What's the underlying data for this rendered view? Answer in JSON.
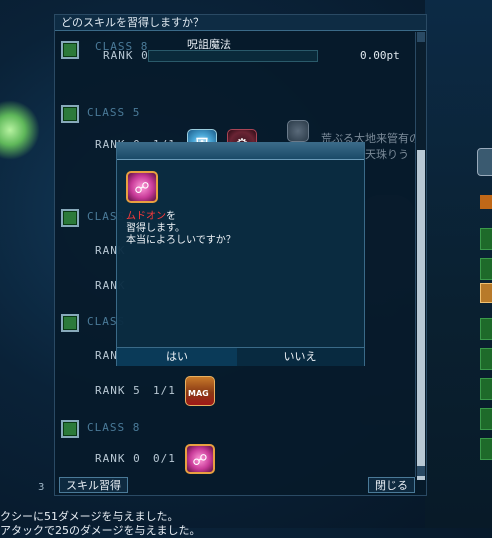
{
  "window": {
    "title": "どのスキルを習得しますか？",
    "header": {
      "class_label": "CLASS 8",
      "rank_label": "RANK 0",
      "spell": "呪詛魔法",
      "points": "0.00pt"
    },
    "note_line1": "荒ぶる大地来管有の新表",
    "note_line2": "天珠りう",
    "footer_left": "スキル習得",
    "footer_right": "閉じる"
  },
  "rows": [
    {
      "type": "class",
      "label": "CLASS 5"
    },
    {
      "type": "rank",
      "label": "RANK 0",
      "count": "1/1"
    },
    {
      "type": "class",
      "label": "CLASS"
    },
    {
      "type": "rank",
      "label": "RANK"
    },
    {
      "type": "rank",
      "label": "RANK"
    },
    {
      "type": "class",
      "label": "CLASS"
    },
    {
      "type": "rank",
      "label": "RANK"
    },
    {
      "type": "rank",
      "label": "RANK 5",
      "count": "1/1"
    },
    {
      "type": "class",
      "label": "CLASS 8"
    },
    {
      "type": "rank",
      "label": "RANK 0",
      "count": "0/1"
    }
  ],
  "dialog": {
    "skill_name": "ムドオン",
    "line1_suffix": "を",
    "line2": "習得します。",
    "line3": "本当によろしいですか？",
    "yes": "はい",
    "no": "いいえ"
  },
  "chat": {
    "tab": "3",
    "line1": "クシーに51ダメージを与えました。",
    "line2": "アタックで25のダメージを与えました。"
  },
  "icons": {
    "blue_emblem": "shield-emblem-icon",
    "red_emblem": "red-gear-icon",
    "purple_skill": "mudoon-curse-icon",
    "mag": "mag-icon"
  }
}
